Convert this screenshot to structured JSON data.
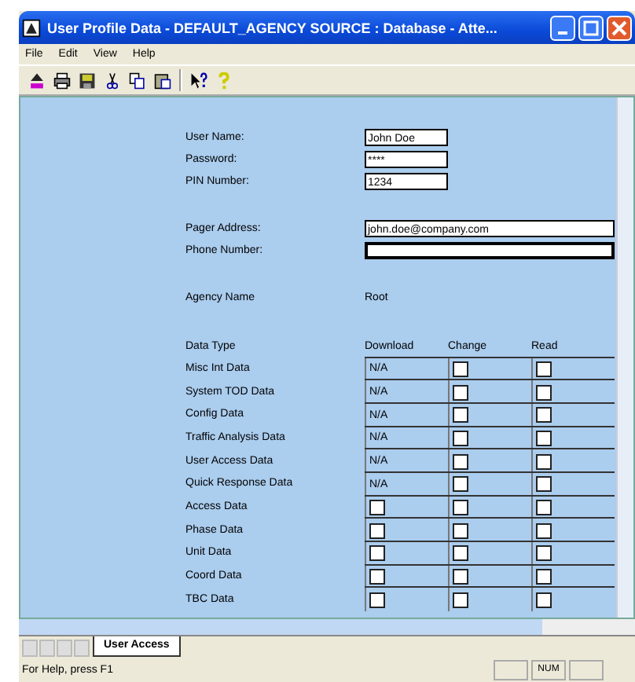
{
  "window": {
    "title": "User Profile Data - DEFAULT_AGENCY     SOURCE : Database  - Atte..."
  },
  "menu": [
    "File",
    "Edit",
    "View",
    "Help"
  ],
  "fields": [
    {
      "label": "User Name:",
      "value": "John Doe",
      "wide": false
    },
    {
      "label": "Password:",
      "value": "****",
      "wide": false
    },
    {
      "label": "PIN Number:",
      "value": "1234",
      "wide": false
    },
    {
      "label": "Pager Address:",
      "value": "john.doe@company.com",
      "wide": true
    },
    {
      "label": "Phone Number:",
      "wide": true
    }
  ],
  "agency": {
    "label": "Agency Name",
    "value": "Root"
  },
  "table": {
    "columns": [
      "Data Type",
      "Download",
      "Change",
      "Read"
    ],
    "rows": [
      {
        "name": "Misc Int Data",
        "download": {
          "kind": "text",
          "text": "N/A"
        },
        "change": false,
        "read": false
      },
      {
        "name": "System TOD Data",
        "download": {
          "kind": "text",
          "text": "N/A"
        },
        "change": false,
        "read": false
      },
      {
        "name": "Config Data",
        "download": {
          "kind": "text",
          "text": "N/A"
        },
        "change": false,
        "read": false
      },
      {
        "name": "Traffic Analysis Data",
        "download": {
          "kind": "text",
          "text": "N/A"
        },
        "change": false,
        "read": false
      },
      {
        "name": "User Access Data",
        "download": {
          "kind": "text",
          "text": "N/A"
        },
        "change": false,
        "read": false
      },
      {
        "name": "Quick Response Data",
        "download": {
          "kind": "text",
          "text": "N/A"
        },
        "change": false,
        "read": false
      },
      {
        "name": "Access Data",
        "download": {
          "kind": "checkbox",
          "checked": false
        },
        "change": false,
        "read": false
      },
      {
        "name": "Phase Data",
        "download": {
          "kind": "checkbox",
          "checked": false
        },
        "change": false,
        "read": false
      },
      {
        "name": "Unit Data",
        "download": {
          "kind": "checkbox",
          "checked": false
        },
        "change": false,
        "read": false
      },
      {
        "name": "Coord Data",
        "download": {
          "kind": "checkbox",
          "checked": false
        },
        "change": false,
        "read": false
      },
      {
        "name": "TBC Data",
        "download": {
          "kind": "checkbox",
          "checked": false
        },
        "change": false,
        "read": false
      }
    ]
  },
  "sheet_tabs": [
    {
      "label": "User Access",
      "selected": true
    }
  ],
  "status_bar": {
    "text": "For Help, press F1",
    "panels": [
      "NUM"
    ]
  }
}
